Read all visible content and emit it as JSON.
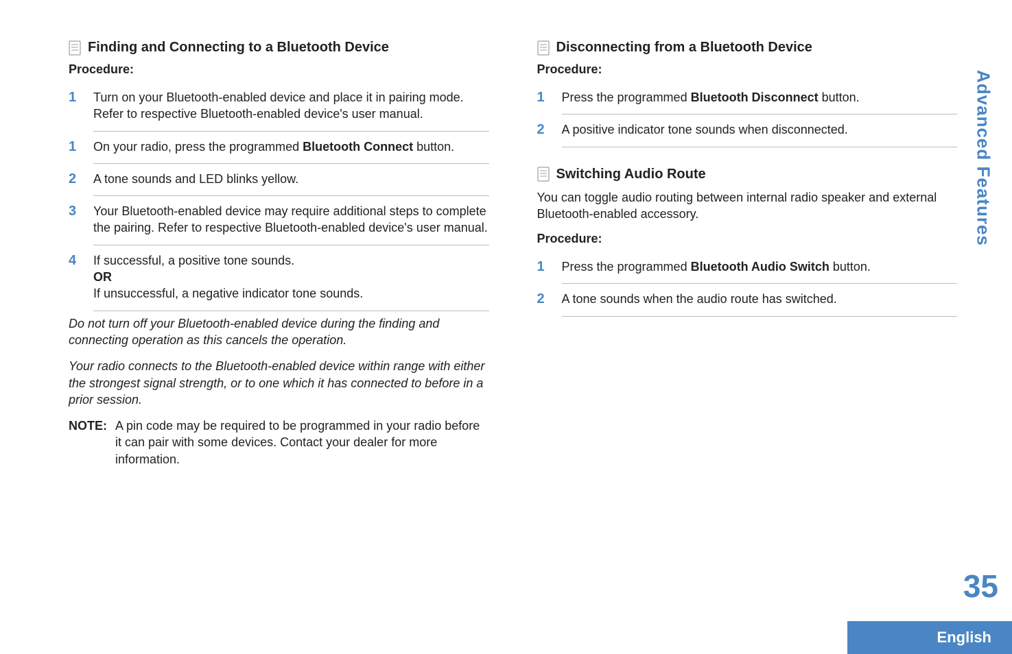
{
  "sideTab": "Advanced Features",
  "pageNumber": "35",
  "footer": "English",
  "left": {
    "heading1": "Finding and Connecting to a Bluetooth Device",
    "proc": "Procedure:",
    "pre_step_num": "1",
    "pre_step_text": "Turn on your Bluetooth-enabled device and place it in pairing mode. Refer to respective Bluetooth-enabled device's user manual.",
    "steps": [
      {
        "num": "1",
        "parts": [
          {
            "t": "On your radio, press the programmed "
          },
          {
            "t": "Bluetooth Connect",
            "bold": true
          },
          {
            "t": " button."
          }
        ]
      },
      {
        "num": "2",
        "parts": [
          {
            "t": "A tone sounds and LED blinks yellow."
          }
        ]
      },
      {
        "num": "3",
        "parts": [
          {
            "t": "Your Bluetooth-enabled device may require additional steps to complete the pairing. Refer to respective Bluetooth-enabled device's user manual."
          }
        ]
      },
      {
        "num": "4",
        "parts": [
          {
            "t": "If successful, a positive tone sounds."
          },
          {
            "br": true
          },
          {
            "t": "OR",
            "bold": true
          },
          {
            "br": true
          },
          {
            "t": "If unsuccessful, a negative indicator tone sounds."
          }
        ]
      }
    ],
    "note1": "Do not turn off your Bluetooth-enabled device during the finding and connecting operation as this cancels the operation.",
    "note2": "Your radio connects to the Bluetooth-enabled device within range with either the strongest signal strength, or to one which it has connected to before in a prior session.",
    "noteLabel": "NOTE:",
    "noteBody": "A pin code may be required to be programmed in your radio before it can pair with some devices. Contact your dealer for more information."
  },
  "right": {
    "heading1": "Disconnecting from a Bluetooth Device",
    "proc1": "Procedure:",
    "steps1": [
      {
        "num": "1",
        "parts": [
          {
            "t": "Press the programmed "
          },
          {
            "t": "Bluetooth Disconnect",
            "bold": true
          },
          {
            "t": " button."
          }
        ]
      },
      {
        "num": "2",
        "parts": [
          {
            "t": "A positive indicator tone sounds when disconnected."
          }
        ]
      }
    ],
    "heading2": "Switching Audio Route",
    "intro2": "You can toggle audio routing between internal radio speaker and external Bluetooth-enabled accessory.",
    "proc2": "Procedure:",
    "steps2": [
      {
        "num": "1",
        "parts": [
          {
            "t": "Press the programmed "
          },
          {
            "t": "Bluetooth Audio Switch",
            "bold": true
          },
          {
            "t": " button."
          }
        ]
      },
      {
        "num": "2",
        "parts": [
          {
            "t": "A tone sounds when the audio route has switched."
          }
        ]
      }
    ]
  }
}
